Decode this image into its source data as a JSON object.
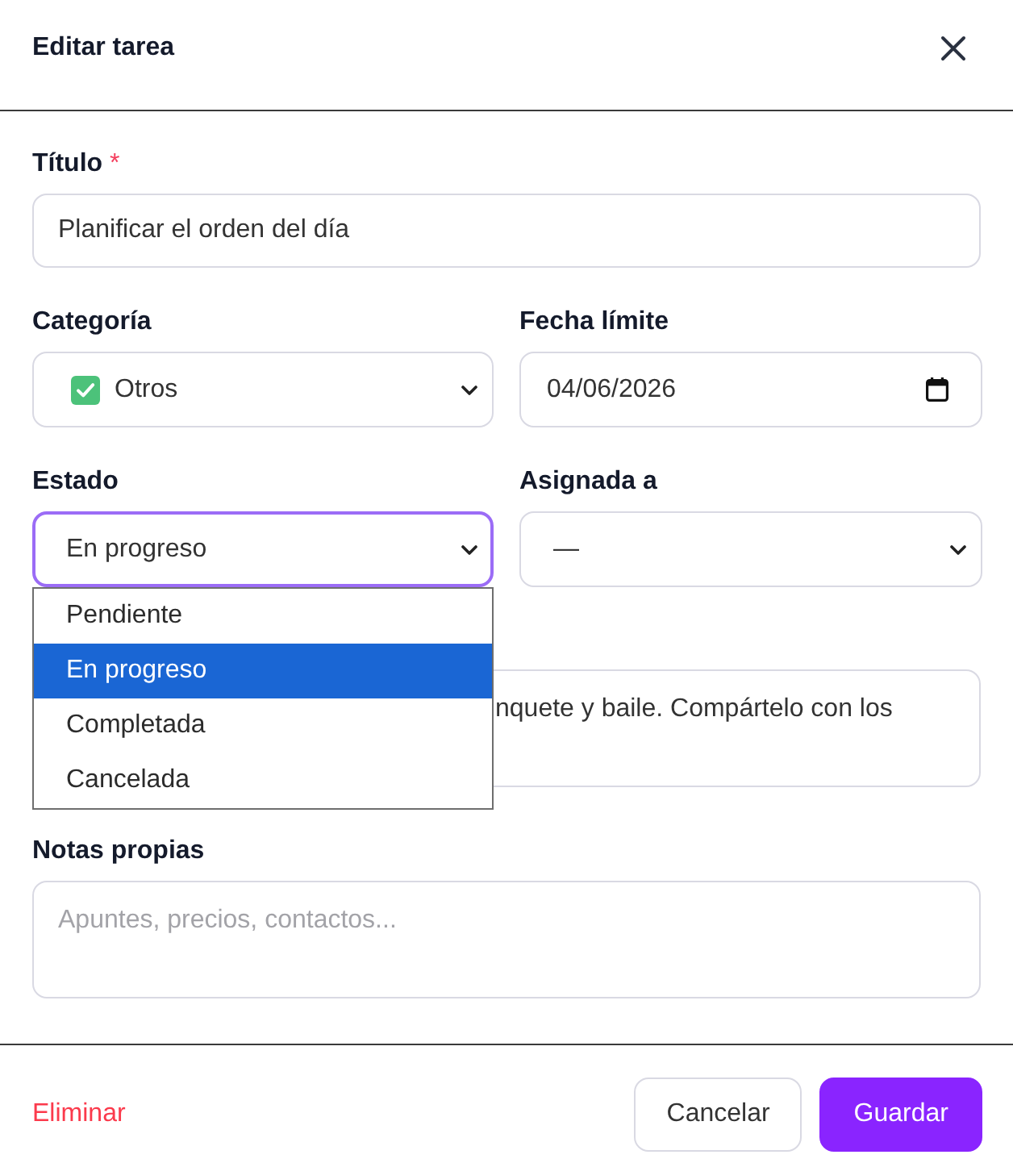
{
  "header": {
    "title": "Editar tarea"
  },
  "title_field": {
    "label": "Título",
    "required_mark": "*",
    "value": "Planificar el orden del día"
  },
  "category": {
    "label": "Categoría",
    "value": "Otros"
  },
  "due_date": {
    "label": "Fecha límite",
    "value": "04/06/2026"
  },
  "status": {
    "label": "Estado",
    "value": "En progreso",
    "expanded": true,
    "options": [
      {
        "label": "Pendiente",
        "selected": false
      },
      {
        "label": "En progreso",
        "selected": true
      },
      {
        "label": "Completada",
        "selected": false
      },
      {
        "label": "Cancelada",
        "selected": false
      }
    ]
  },
  "assignee": {
    "label": "Asignada a",
    "value": "—"
  },
  "description": {
    "value": "nquete y baile. Compártelo con los"
  },
  "own_notes": {
    "label": "Notas propias",
    "placeholder": "Apuntes, precios, contactos..."
  },
  "footer": {
    "delete": "Eliminar",
    "cancel": "Cancelar",
    "save": "Guardar"
  }
}
